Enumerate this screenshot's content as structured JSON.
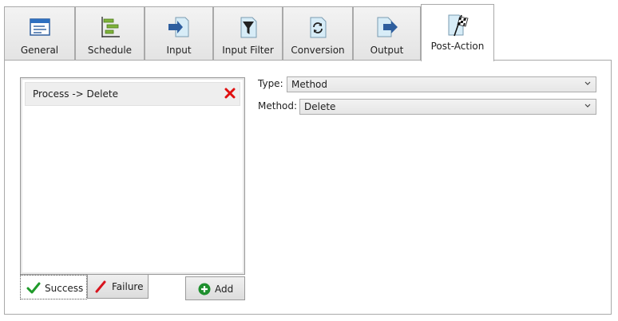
{
  "tabs": [
    {
      "id": "general",
      "label": "General",
      "icon": "general-window-icon"
    },
    {
      "id": "schedule",
      "label": "Schedule",
      "icon": "schedule-gantt-icon"
    },
    {
      "id": "input",
      "label": "Input",
      "icon": "input-arrow-icon"
    },
    {
      "id": "input-filter",
      "label": "Input Filter",
      "icon": "filter-funnel-icon"
    },
    {
      "id": "conversion",
      "label": "Conversion",
      "icon": "conversion-refresh-icon"
    },
    {
      "id": "output",
      "label": "Output",
      "icon": "output-arrow-icon"
    },
    {
      "id": "post-action",
      "label": "Post-Action",
      "icon": "checkered-flag-icon",
      "active": true
    }
  ],
  "post_action": {
    "list_items": [
      {
        "label": "Process -> Delete"
      }
    ],
    "success_button": "Success",
    "failure_button": "Failure",
    "add_button": "Add",
    "type_label": "Type:",
    "type_value": "Method",
    "method_label": "Method:",
    "method_value": "Delete"
  },
  "colors": {
    "accent_blue": "#2e5e9e",
    "delete_red": "#e01010",
    "success_green": "#1f9a2a",
    "failure_red": "#d8141e",
    "add_green": "#1e8f2e"
  }
}
